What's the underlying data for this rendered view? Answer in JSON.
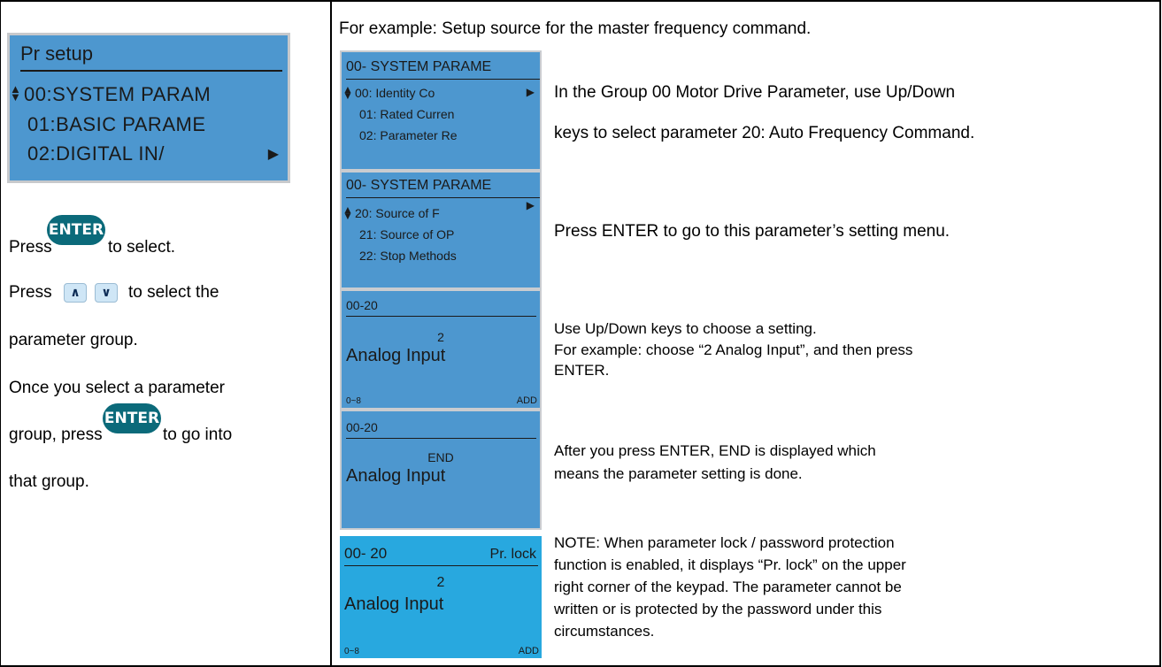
{
  "left": {
    "lcd": {
      "title": "Pr setup",
      "rows": [
        "00:SYSTEM PARAM",
        "01:BASIC PARAME",
        "02:DIGITAL IN/"
      ],
      "up_down_arrow": "▲▼",
      "more_arrow": "▶"
    },
    "press1_a": "Press",
    "press1_b": "to select.",
    "press2_a": "Press",
    "press2_b": "to select the",
    "press2_c": "parameter group.",
    "once_line": "Once you select a parameter",
    "group_press_a": "group, press",
    "group_press_b": "to go into",
    "that_group": "that group.",
    "enter_key": "ENTER",
    "up_key": "^",
    "down_key": "v"
  },
  "right": {
    "header": "For example: Setup source for the master frequency command.",
    "menu1": {
      "title": "00- SYSTEM PARAME",
      "rows": [
        "00: Identity Co",
        "01: Rated Curren",
        "02: Parameter Re"
      ],
      "desc1": "In the Group 00 Motor Drive Parameter, use Up/Down",
      "desc2": "keys to select parameter 20: Auto Frequency Command."
    },
    "menu2": {
      "title": "00- SYSTEM PARAME",
      "rows": [
        "20: Source of F",
        "21: Source of OP",
        "22: Stop Methods"
      ],
      "desc": "Press ENTER to go to this parameter’s setting menu."
    },
    "val1": {
      "code": "00-20",
      "value": "2",
      "name": "Analog Input",
      "range": "0~8",
      "add": "ADD",
      "desc1": "Use Up/Down keys to choose a setting.",
      "desc2": "For example: choose “2 Analog Input”, and then press",
      "desc3": "ENTER."
    },
    "val2": {
      "code": "00-20",
      "value": "END",
      "name": "Analog Input",
      "desc1": "After you press ENTER, END is displayed which",
      "desc2": "means the parameter setting is done."
    },
    "val3": {
      "code": "00- 20",
      "lock": "Pr. lock",
      "value": "2",
      "name": "Analog Input",
      "range": "0~8",
      "add": "ADD",
      "note": [
        "NOTE: When parameter lock / password protection",
        "function is enabled, it displays “Pr. lock” on the upper",
        "right corner of the keypad. The parameter cannot be",
        "written or is protected by the password under this",
        "circumstances."
      ]
    },
    "arrow_ud": "▲▼",
    "arrow_right": "▶"
  }
}
